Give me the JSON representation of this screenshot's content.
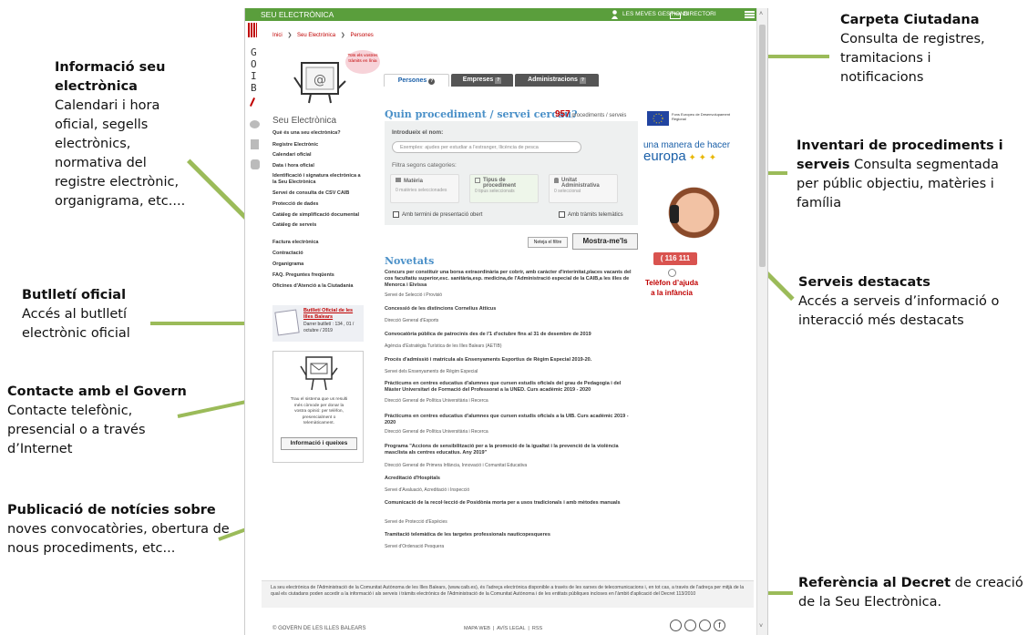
{
  "annotations": {
    "info_seu": {
      "title": "Informació seu electrònica",
      "text": "Calendari i hora oficial, segells electrònics, normativa del registre electrònic, organigrama, etc...."
    },
    "butlleti": {
      "title": "Butlletí oficial",
      "text": "Accés al butlletí electrònic oficial"
    },
    "contacte": {
      "title": "Contacte amb el Govern",
      "text": "Contacte telefònic, presencial o a través d’Internet"
    },
    "noticies": {
      "title": "Publicació de notícies sobre",
      "text": "noves  convocatòries, obertura de nous procediments, etc..."
    },
    "carpeta": {
      "title": "Carpeta Ciutadana",
      "text": "Consulta de registres, tramitacions i notificacions"
    },
    "inventari": {
      "title": "Inventari de procediments i serveis",
      "text": "Consulta segmentada per públic objectiu, matèries i família"
    },
    "serveis": {
      "title": "Serveis destacats",
      "text": "Accés a serveis d’informació o interacció més destacats"
    },
    "decret": {
      "title": "Referència al Decret",
      "text": "de creació de la Seu Electrònica."
    }
  },
  "site": {
    "header_title": "SEU ELECTRÒNICA",
    "my_procedures": "LES MEVES GESTIONS",
    "directory": "DIRECTORI",
    "logo_letters": [
      "G",
      "O",
      "I",
      "B"
    ],
    "breadcrumb": [
      "Inici",
      "Seu Electrònica",
      "Persones"
    ],
    "bubble": "Tots els vostres tràmits en línia",
    "sidebar_title": "Seu Electrònica",
    "sidebar_items": [
      "Què és una seu electrònica?",
      "Registre Electrònic",
      "Calendari oficial",
      "Data i hora oficial",
      "Identificació i signatura electrònica a la Seu Electrònica",
      "Servei de consulta de CSV CAIB",
      "Protecció de dades",
      "Catàleg de simplificació documental",
      "Catàleg de serveis",
      "Factura electrònica",
      "Contractació",
      "Organigrama",
      "FAQ. Preguntes freqüents",
      "Oficines d'Atenció a la Ciutadania"
    ],
    "boletin_title": "Butlletí Oficial de les Illes Balears",
    "boletin_last": "Darrer butlletí : 134 , 01 / octubre / 2019",
    "contact_text": "Trau el sistema que us resulti més còmode per donar la vostra opinió: per telèfon, presencialment o telemàticament.",
    "contact_button": "Informació i queixes",
    "tabs": [
      "Persones",
      "Empreses",
      "Administracions"
    ],
    "search_heading": "Quin procediment / servei cercau?",
    "proc_count": "957",
    "proc_count_label": "procediments / serveis",
    "name_label": "Introdueix el nom:",
    "name_placeholder": "Exemples: ajudes per estudiar a l'estranger, llicència de pesca",
    "filter_label": "Filtra segons categories:",
    "categories": [
      {
        "title": "Matèria",
        "sub": "0 matèries seleccionades"
      },
      {
        "title": "Tipus de procediment",
        "sub": "0 tipus seleccionats"
      },
      {
        "title": "Unitat Administrativa",
        "sub": "0 seleccionat"
      }
    ],
    "check_deadline": "Amb termini de presentació obert",
    "check_telematic": "Amb tràmits telemàtics",
    "clear_filter": "Neteja el filtre",
    "show_button": "Mostra-me'ls",
    "eu_text": "Fons Europeu de Desenvolupament Regional",
    "eu_slogan_1": "una manera de hacer",
    "eu_slogan_2": "europa",
    "helpline_number": "116 111",
    "helpline_text": "Telèfon d’ajuda a la infància",
    "news_heading": "Novetats",
    "news": [
      {
        "title": "Concurs per constituir una borsa extraordinària per cobrir, amb caràcter d'interinitat,places vacants del cos facultatiu superior,esc. sanitària,esp. medicina,de l'Administració especial de la CAIB,a les illes de Menorca i Eivissa",
        "source": "Servei de Selecció i Provisió"
      },
      {
        "title": "Concessió de les distincions Cornelius Atticus",
        "source": "Direcció General d'Esports"
      },
      {
        "title": "Convocatòria pública de patrocinis des de l'1 d'octubre fins al 31 de desembre de 2019",
        "source": "Agència d'Estratègia Turística de les Illes Balears (AETIB)"
      },
      {
        "title": "Procés d'admissió i matrícula als Ensenyaments Esportius de Règim Especial 2019-20.",
        "source": "Servei dels Ensenyaments de Règim Especial"
      },
      {
        "title": "Pràcticums en centres educatius d'alumnes que cursen estudis oficials del grau de Pedagogia i del Màster Universitari de Formació del Professorat a la UNED. Curs acadèmic 2019 - 2020",
        "source": "Direcció General de Política Universitària i Recerca"
      },
      {
        "title": "Pràcticums en centres educatius d'alumnes que cursen estudis oficials a la UIB. Curs acadèmic 2019 - 2020",
        "source": "Direcció General de Política Universitària i Recerca"
      },
      {
        "title": "Programa \"Accions de sensibilització per a la promoció de la igualtat i la prevenció de la violència masclista als centres educatius. Any 2019\"",
        "source": "Direcció General de Primera Infància, Innovació i Comunitat Educativa"
      },
      {
        "title": "Acreditació d'Hospitals",
        "source": "Servei d'Avaluació, Acreditació i Inspecció"
      },
      {
        "title": "Comunicació de la recol·lecció de Posidònia morta per a usos tradicionals i amb mètodes manuals",
        "source": "Servei de Protecció d'Espècies"
      },
      {
        "title": "Tramitació telemàtica de les targetes professionals nauticopesqueres",
        "source": "Servei d'Ordenació Pesquera"
      }
    ],
    "footer_text": "La seu electrònica de l'Administració de la Comunitat Autònoma de les Illes Balears, (www.caib.es), és l'adreça electrònica disponible a través de les xarxes de telecomunicacions i, en tot cas, a través de l'adreça per mitjà de la qual els ciutadans poden accedir a la informació i als serveis i tràmits electrònics de l'Administració de la Comunitat Autònoma i de les entitats públiques incloses en l'àmbit d'aplicació del Decret 113/2010",
    "copyright": "© GOVERN DE LES ILLES BALEARS",
    "footer_links": "MAPA WEB  |  AVÍS LEGAL  |  RSS"
  },
  "colors": {
    "green": "#5a9e3c",
    "annot_line": "#9bbb59",
    "link_blue": "#1a5fa8",
    "red": "#c00000"
  }
}
